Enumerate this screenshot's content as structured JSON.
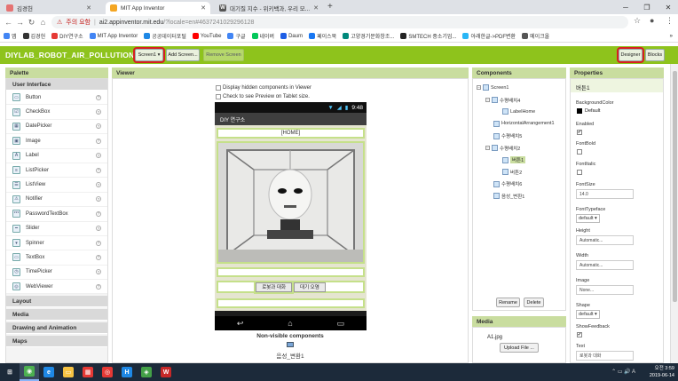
{
  "browser": {
    "tabs": [
      {
        "label": "김경헌",
        "active": false,
        "favicon_color": "#e57373"
      },
      {
        "label": "MIT App Inventor",
        "active": true,
        "favicon_color": "#f4a623"
      },
      {
        "label": "대기질 지수 - 위키백과, 우리 모...",
        "active": false,
        "favicon_color": "#555555"
      }
    ],
    "new_tab_symbol": "+",
    "address": {
      "security_label": "주의 요함",
      "url_host": "ai2.appinventor.mit.edu",
      "url_rest": "/?locale=en#4637241029296128"
    },
    "bookmarks": [
      {
        "label": "앱",
        "icon": "apps-icon",
        "color": "#4285f4"
      },
      {
        "label": "김경헌",
        "icon": "blog-icon",
        "color": "#333333"
      },
      {
        "label": "DIY연구소",
        "icon": "diy-icon",
        "color": "#e53935"
      },
      {
        "label": "MIT App Inventor",
        "icon": "google-icon",
        "color": "#4285f4"
      },
      {
        "label": "공공데이터포털",
        "icon": "data-icon",
        "color": "#1e88e5"
      },
      {
        "label": "YouTube",
        "icon": "youtube-icon",
        "color": "#ff0000"
      },
      {
        "label": "구글",
        "icon": "google-icon",
        "color": "#4285f4"
      },
      {
        "label": "네이버",
        "icon": "naver-icon",
        "color": "#03c75a"
      },
      {
        "label": "Daum",
        "icon": "daum-icon",
        "color": "#1e5ee5"
      },
      {
        "label": "페이스북",
        "icon": "facebook-icon",
        "color": "#1877f2"
      },
      {
        "label": "고양경기문화창조...",
        "icon": "culture-icon",
        "color": "#00897b"
      },
      {
        "label": "SMTECH 중소기업...",
        "icon": "smtech-icon",
        "color": "#222222"
      },
      {
        "label": "아래한글->PDF변환",
        "icon": "pdf-icon",
        "color": "#29b6f6"
      },
      {
        "label": "메이크올",
        "icon": "make-icon",
        "color": "#555555"
      }
    ],
    "bookmarks_more": "»"
  },
  "app": {
    "project_name": "DIYLAB_ROBOT_AIR_POLLUTION2",
    "screen_selector": "Screen1 ▾",
    "add_screen": "Add Screen...",
    "remove_screen": "Remove Screen",
    "designer": "Designer",
    "blocks": "Blocks"
  },
  "palette": {
    "title": "Palette",
    "category_open": "User Interface",
    "items": [
      {
        "label": "Button",
        "icon": "button-icon"
      },
      {
        "label": "CheckBox",
        "icon": "checkbox-icon"
      },
      {
        "label": "DatePicker",
        "icon": "datepicker-icon"
      },
      {
        "label": "Image",
        "icon": "image-icon"
      },
      {
        "label": "Label",
        "icon": "label-icon"
      },
      {
        "label": "ListPicker",
        "icon": "listpicker-icon"
      },
      {
        "label": "ListView",
        "icon": "listview-icon"
      },
      {
        "label": "Notifier",
        "icon": "notifier-icon"
      },
      {
        "label": "PasswordTextBox",
        "icon": "password-icon"
      },
      {
        "label": "Slider",
        "icon": "slider-icon"
      },
      {
        "label": "Spinner",
        "icon": "spinner-icon"
      },
      {
        "label": "TextBox",
        "icon": "textbox-icon"
      },
      {
        "label": "TimePicker",
        "icon": "timepicker-icon"
      },
      {
        "label": "WebViewer",
        "icon": "webviewer-icon"
      }
    ],
    "help_symbol": "?",
    "categories": [
      "Layout",
      "Media",
      "Drawing and Animation",
      "Maps"
    ]
  },
  "viewer": {
    "title": "Viewer",
    "hidden_components_label": "Display hidden components in Viewer",
    "tablet_preview_label": "Check to see Preview on Tablet size.",
    "phone": {
      "time": "9:48",
      "app_title": "DIY 연구소",
      "home_button": "[HOME]",
      "button_talk": "로봇과 대화",
      "button_air": "대기 오염"
    },
    "nonvisible_title": "Non-visible components",
    "nonvisible_item": "음성_변환1"
  },
  "components": {
    "title": "Components",
    "tree": [
      {
        "label": "Screen1",
        "level": 0,
        "toggle": "⊟",
        "selected": false
      },
      {
        "label": "수평배치4",
        "level": 1,
        "toggle": "⊟",
        "selected": false
      },
      {
        "label": "LabelHome",
        "level": 2,
        "toggle": "",
        "selected": false
      },
      {
        "label": "HorizontalArrangement1",
        "level": 1,
        "toggle": "",
        "selected": false
      },
      {
        "label": "수평배치5",
        "level": 1,
        "toggle": "",
        "selected": false
      },
      {
        "label": "수평배치2",
        "level": 1,
        "toggle": "⊟",
        "selected": false
      },
      {
        "label": "버튼1",
        "level": 2,
        "toggle": "",
        "selected": true
      },
      {
        "label": "버튼2",
        "level": 2,
        "toggle": "",
        "selected": false
      },
      {
        "label": "수평배치6",
        "level": 1,
        "toggle": "",
        "selected": false
      },
      {
        "label": "음성_변환1",
        "level": 1,
        "toggle": "",
        "selected": false
      }
    ],
    "rename": "Rename",
    "delete": "Delete"
  },
  "media": {
    "title": "Media",
    "file": "A1.jpg",
    "upload": "Upload File ..."
  },
  "properties": {
    "title": "Properties",
    "component": "버튼1",
    "background_color_label": "BackgroundColor",
    "background_color_value": "Default",
    "enabled_label": "Enabled",
    "enabled": true,
    "fontbold_label": "FontBold",
    "fontbold": false,
    "fontitalic_label": "FontItalic",
    "fontitalic": false,
    "fontsize_label": "FontSize",
    "fontsize_value": "14.0",
    "fonttypeface_label": "FontTypeface",
    "fonttypeface_value": "default ▾",
    "height_label": "Height",
    "height_value": "Automatic...",
    "width_label": "Width",
    "width_value": "Automatic...",
    "image_label": "Image",
    "image_value": "None...",
    "shape_label": "Shape",
    "shape_value": "default ▾",
    "showfeedback_label": "ShowFeedback",
    "showfeedback": true,
    "text_label": "Text",
    "text_value": "로봇과 대화"
  },
  "taskbar": {
    "apps": [
      {
        "name": "start-icon",
        "color": "#ffffff"
      },
      {
        "name": "chrome-icon",
        "color": "#4caf50"
      },
      {
        "name": "edge-icon",
        "color": "#1e88e5"
      },
      {
        "name": "explorer-icon",
        "color": "#f6c343"
      },
      {
        "name": "app-icon",
        "color": "#e53935"
      },
      {
        "name": "app2-icon",
        "color": "#e53935"
      },
      {
        "name": "hangul-icon",
        "color": "#1e88e5"
      },
      {
        "name": "app3-icon",
        "color": "#43a047"
      },
      {
        "name": "word-icon",
        "color": "#c62828"
      }
    ],
    "time": "오전 3:59",
    "date": "2019-06-14"
  }
}
